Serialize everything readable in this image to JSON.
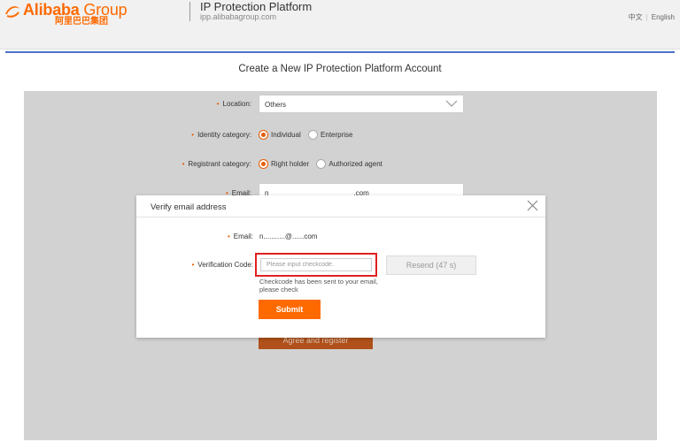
{
  "header": {
    "logo_en_main": "Alibaba",
    "logo_en_group": " Group",
    "logo_cn": "阿里巴巴集团",
    "platform_title": "IP Protection Platform",
    "platform_url": "ipp.alibabagroup.com",
    "lang_cn": "中文",
    "lang_en": "English"
  },
  "page": {
    "heading": "Create a New IP Protection Platform Account"
  },
  "form": {
    "location_label": "Location:",
    "location_value": "Others",
    "identity_label": "Identity category:",
    "identity_options": [
      "Individual",
      "Enterprise"
    ],
    "identity_selected": "Individual",
    "registrant_label": "Registrant category:",
    "registrant_options": [
      "Right holder",
      "Authorized agent"
    ],
    "registrant_selected": "Right holder",
    "email_label": "Email:",
    "email_value_start": "n",
    "email_value_end": ".com",
    "agree_button": "Agree and register"
  },
  "modal": {
    "title": "Verify email address",
    "email_label": "Email:",
    "email_value": "n...........@......com",
    "code_label": "Verification Code:",
    "code_placeholder": "Please input checkcode.",
    "resend_label": "Resend (47 s)",
    "hint": "Checkcode has been sent to your email, please check",
    "submit_label": "Submit"
  },
  "colors": {
    "brand_orange": "#ff6a00",
    "accent_blue": "#4a74c9",
    "highlight_red": "#e02020"
  }
}
